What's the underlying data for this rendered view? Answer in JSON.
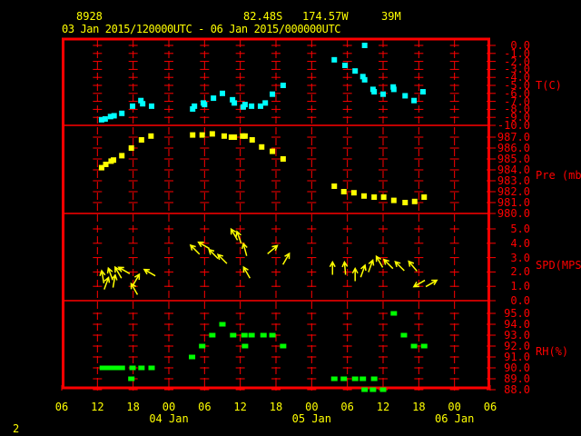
{
  "header": {
    "station_id": "8928",
    "latitude": "82.48S",
    "longitude": "174.57W",
    "elevation": "39M",
    "time_range": "03 Jan 2015/120000UTC - 06 Jan 2015/000000UTC"
  },
  "page_number": "2",
  "colors": {
    "frame": "#ff0000",
    "text": "#ffff00",
    "temperature": "#00ffff",
    "pressure": "#ffff00",
    "wind": "#ffff00",
    "rh": "#00ff00"
  },
  "chart_data": {
    "type": "scatter",
    "x_unit": "hours since 03 Jan 2015 06UTC",
    "xlim": [
      0,
      72
    ],
    "x_ticks": [
      "06",
      "12",
      "18",
      "00",
      "06",
      "12",
      "18",
      "00",
      "06",
      "12",
      "18",
      "00",
      "06"
    ],
    "x_day_labels": [
      {
        "label": "04 Jan",
        "at_hour": 18
      },
      {
        "label": "05 Jan",
        "at_hour": 42
      },
      {
        "label": "06 Jan",
        "at_hour": 66
      }
    ],
    "panels": [
      {
        "name": "T(C)",
        "ylim": [
          -10,
          0
        ],
        "ticks": [
          "0.0",
          "-1.0",
          "-2.0",
          "-3.0",
          "-4.0",
          "-5.0",
          "-6.0",
          "-7.0",
          "-8.0",
          "-9.0",
          "-10.0"
        ],
        "points": [
          [
            6.7,
            -9.3
          ],
          [
            7.3,
            -9.2
          ],
          [
            8.2,
            -8.9
          ],
          [
            8.8,
            -8.8
          ],
          [
            10.1,
            -8.5
          ],
          [
            11.9,
            -7.6
          ],
          [
            13.3,
            -6.9
          ],
          [
            13.6,
            -7.3
          ],
          [
            15.1,
            -7.6
          ],
          [
            22.0,
            -7.95
          ],
          [
            22.3,
            -7.6
          ],
          [
            23.8,
            -7.2
          ],
          [
            24.0,
            -7.4
          ],
          [
            25.5,
            -6.6
          ],
          [
            27.0,
            -6.0
          ],
          [
            28.7,
            -6.8
          ],
          [
            29.0,
            -7.2
          ],
          [
            30.5,
            -7.7
          ],
          [
            30.8,
            -7.4
          ],
          [
            31.9,
            -7.6
          ],
          [
            33.4,
            -7.6
          ],
          [
            34.2,
            -7.2
          ],
          [
            35.4,
            -6.1
          ],
          [
            37.2,
            -5.0
          ],
          [
            45.8,
            -1.8
          ],
          [
            47.6,
            -2.5
          ],
          [
            49.3,
            -3.2
          ],
          [
            50.6,
            -3.9
          ],
          [
            50.9,
            -4.3
          ],
          [
            50.9,
            0.0
          ],
          [
            52.3,
            -5.5
          ],
          [
            52.5,
            -5.8
          ],
          [
            54.0,
            -6.1
          ],
          [
            55.7,
            -5.2
          ],
          [
            55.8,
            -5.5
          ],
          [
            57.7,
            -6.3
          ],
          [
            59.2,
            -6.9
          ],
          [
            60.7,
            -5.8
          ]
        ]
      },
      {
        "name": "Pre (mb)",
        "ylim": [
          980,
          987
        ],
        "ticks": [
          "987.0",
          "986.0",
          "985.0",
          "984.0",
          "983.0",
          "982.0",
          "981.0",
          "980.0"
        ],
        "points": [
          [
            6.7,
            984.2
          ],
          [
            7.4,
            984.5
          ],
          [
            8.3,
            984.8
          ],
          [
            8.7,
            984.9
          ],
          [
            10.1,
            985.3
          ],
          [
            11.7,
            986.0
          ],
          [
            13.4,
            986.75
          ],
          [
            15.0,
            987.1
          ],
          [
            22.0,
            987.2
          ],
          [
            23.6,
            987.2
          ],
          [
            25.3,
            987.3
          ],
          [
            27.3,
            987.1
          ],
          [
            28.5,
            987.0
          ],
          [
            29.0,
            987.0
          ],
          [
            30.4,
            987.1
          ],
          [
            30.8,
            987.1
          ],
          [
            32.0,
            986.75
          ],
          [
            33.6,
            986.1
          ],
          [
            35.4,
            985.7
          ],
          [
            37.2,
            985.0
          ],
          [
            45.8,
            982.5
          ],
          [
            47.4,
            982.0
          ],
          [
            49.1,
            981.9
          ],
          [
            50.8,
            981.6
          ],
          [
            52.5,
            981.5
          ],
          [
            54.1,
            981.5
          ],
          [
            55.8,
            981.2
          ],
          [
            57.7,
            981.0
          ],
          [
            59.3,
            981.1
          ],
          [
            60.9,
            981.5
          ]
        ]
      },
      {
        "name": "SPD(MPS)",
        "ylim": [
          0,
          5
        ],
        "ticks": [
          "5.0",
          "4.0",
          "3.0",
          "2.0",
          "1.0",
          "0.0"
        ],
        "vectors": [
          [
            6.9,
            1.65,
            350
          ],
          [
            7.5,
            1.2,
            20
          ],
          [
            8.2,
            1.85,
            340
          ],
          [
            8.8,
            1.35,
            10
          ],
          [
            9.5,
            1.95,
            330
          ],
          [
            10.5,
            2.1,
            300
          ],
          [
            12.2,
            0.8,
            330
          ],
          [
            12.5,
            1.45,
            30
          ],
          [
            14.8,
            1.95,
            300
          ],
          [
            22.4,
            3.55,
            315
          ],
          [
            23.9,
            3.85,
            300
          ],
          [
            25.5,
            3.25,
            315
          ],
          [
            27.0,
            2.9,
            315
          ],
          [
            29.0,
            4.6,
            330
          ],
          [
            29.8,
            4.4,
            340
          ],
          [
            30.8,
            3.55,
            345
          ],
          [
            31.1,
            1.95,
            330
          ],
          [
            35.4,
            3.55,
            50
          ],
          [
            37.7,
            2.9,
            30
          ],
          [
            45.5,
            2.25,
            0
          ],
          [
            47.6,
            2.25,
            355
          ],
          [
            49.3,
            1.8,
            0
          ],
          [
            50.6,
            2.05,
            20
          ],
          [
            51.9,
            2.4,
            20
          ],
          [
            53.4,
            2.7,
            330
          ],
          [
            54.9,
            2.55,
            315
          ],
          [
            56.8,
            2.4,
            315
          ],
          [
            59.0,
            2.4,
            320
          ],
          [
            60.1,
            1.2,
            240
          ],
          [
            62.1,
            1.2,
            60
          ]
        ]
      },
      {
        "name": "RH(%)",
        "ylim": [
          88,
          95
        ],
        "ticks": [
          "95.0",
          "94.0",
          "93.0",
          "92.0",
          "91.0",
          "90.0",
          "89.0",
          "88.0"
        ],
        "points": [
          [
            6.9,
            90
          ],
          [
            7.4,
            90
          ],
          [
            8.4,
            90
          ],
          [
            9.1,
            90
          ],
          [
            10.1,
            90
          ],
          [
            11.9,
            90
          ],
          [
            11.7,
            89
          ],
          [
            13.4,
            90
          ],
          [
            15.1,
            90
          ],
          [
            21.9,
            91
          ],
          [
            23.6,
            92
          ],
          [
            25.3,
            93
          ],
          [
            27.0,
            94
          ],
          [
            28.8,
            93
          ],
          [
            30.7,
            93
          ],
          [
            30.8,
            92
          ],
          [
            31.9,
            93
          ],
          [
            33.9,
            93
          ],
          [
            35.4,
            93
          ],
          [
            37.2,
            92
          ],
          [
            45.8,
            89
          ],
          [
            47.4,
            89
          ],
          [
            49.3,
            89
          ],
          [
            50.6,
            89
          ],
          [
            52.5,
            89
          ],
          [
            50.9,
            88
          ],
          [
            52.3,
            88
          ],
          [
            54.0,
            88
          ],
          [
            55.8,
            95
          ],
          [
            57.5,
            93
          ],
          [
            59.2,
            92
          ],
          [
            60.9,
            92
          ]
        ]
      }
    ]
  }
}
